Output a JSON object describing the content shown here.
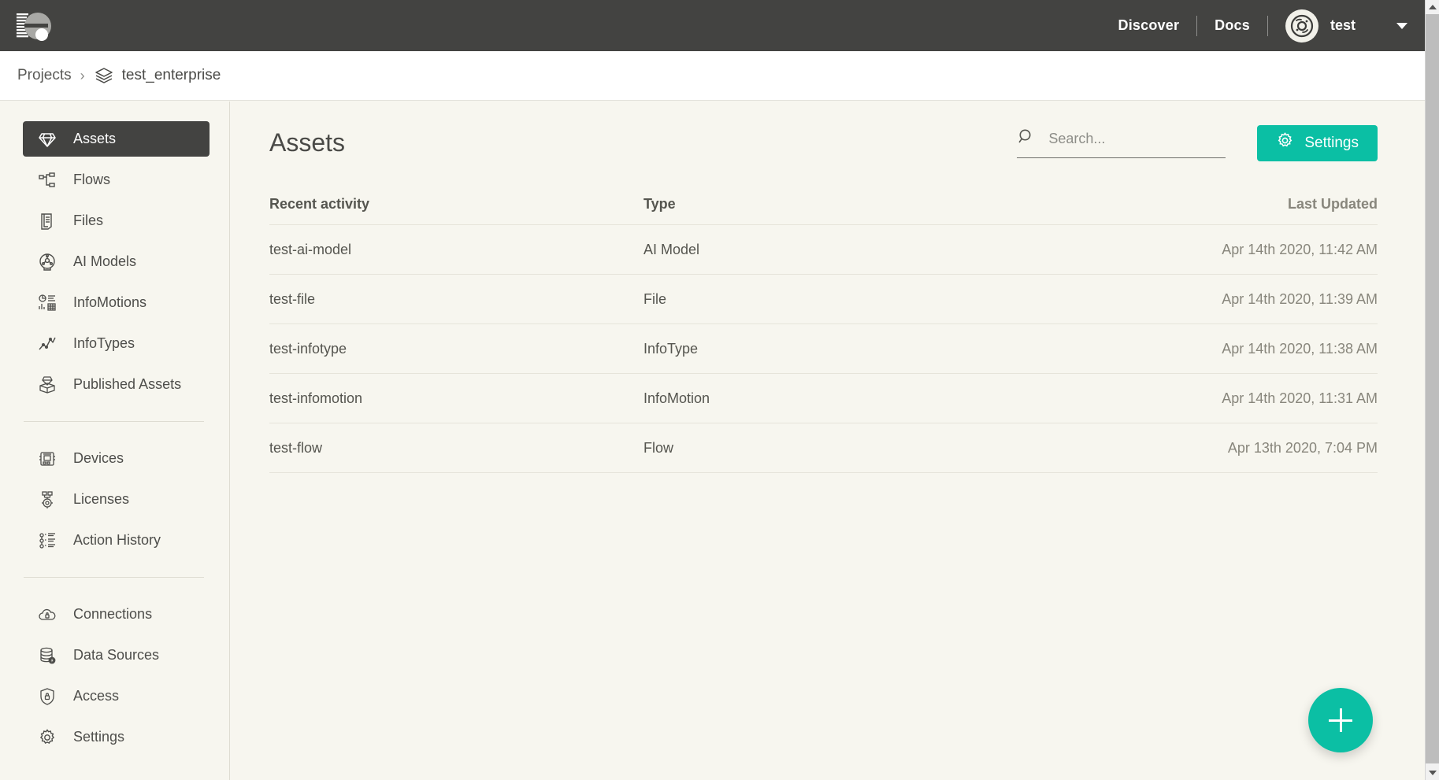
{
  "topbar": {
    "logo_name": "enterprise-logo",
    "links": [
      {
        "label": "Discover"
      },
      {
        "label": "Docs"
      }
    ],
    "user": {
      "name": "test",
      "avatar_icon": "user-avatar-icon",
      "caret_icon": "chevron-down-icon"
    }
  },
  "breadcrumb": {
    "root_label": "Projects",
    "separator": "›",
    "project_icon": "layers-icon",
    "current_label": "test_enterprise"
  },
  "sidebar": {
    "groups": [
      {
        "items": [
          {
            "label": "Assets",
            "icon": "diamond-icon",
            "active": true
          },
          {
            "label": "Flows",
            "icon": "flow-nodes-icon",
            "active": false
          },
          {
            "label": "Files",
            "icon": "file-document-icon",
            "active": false
          },
          {
            "label": "AI Models",
            "icon": "ai-model-icon",
            "active": false
          },
          {
            "label": "InfoMotions",
            "icon": "dashboard-charts-icon",
            "active": false
          },
          {
            "label": "InfoTypes",
            "icon": "line-chart-icon",
            "active": false
          },
          {
            "label": "Published Assets",
            "icon": "published-gem-icon",
            "active": false
          }
        ]
      },
      {
        "items": [
          {
            "label": "Devices",
            "icon": "device-chip-icon",
            "active": false
          },
          {
            "label": "Licenses",
            "icon": "license-gear-icon",
            "active": false
          },
          {
            "label": "Action History",
            "icon": "action-history-icon",
            "active": false
          }
        ]
      },
      {
        "items": [
          {
            "label": "Connections",
            "icon": "cloud-lock-icon",
            "active": false
          },
          {
            "label": "Data Sources",
            "icon": "database-bolt-icon",
            "active": false
          },
          {
            "label": "Access",
            "icon": "shield-lock-icon",
            "active": false
          },
          {
            "label": "Settings",
            "icon": "gear-icon",
            "active": false
          }
        ]
      }
    ]
  },
  "main": {
    "title": "Assets",
    "search": {
      "placeholder": "Search...",
      "value": "",
      "icon": "search-icon"
    },
    "settings_button": {
      "label": "Settings",
      "icon": "gear-icon"
    },
    "table": {
      "headers": {
        "name": "Recent activity",
        "type": "Type",
        "updated": "Last Updated"
      },
      "rows": [
        {
          "name": "test-ai-model",
          "type": "AI Model",
          "updated": "Apr 14th 2020, 11:42 AM"
        },
        {
          "name": "test-file",
          "type": "File",
          "updated": "Apr 14th 2020, 11:39 AM"
        },
        {
          "name": "test-infotype",
          "type": "InfoType",
          "updated": "Apr 14th 2020, 11:38 AM"
        },
        {
          "name": "test-infomotion",
          "type": "InfoMotion",
          "updated": "Apr 14th 2020, 11:31 AM"
        },
        {
          "name": "test-flow",
          "type": "Flow",
          "updated": "Apr 13th 2020, 7:04 PM"
        }
      ]
    },
    "fab": {
      "icon": "plus-icon",
      "label": "+"
    }
  },
  "colors": {
    "accent": "#0bbfa4",
    "topbar_bg": "#434341",
    "page_bg": "#f7f6ef",
    "breadcrumb_bg": "#ffffff",
    "active_nav_bg": "#434341"
  },
  "scrollbar": {
    "up_icon": "scroll-up-arrow-icon",
    "down_icon": "scroll-down-arrow-icon"
  }
}
